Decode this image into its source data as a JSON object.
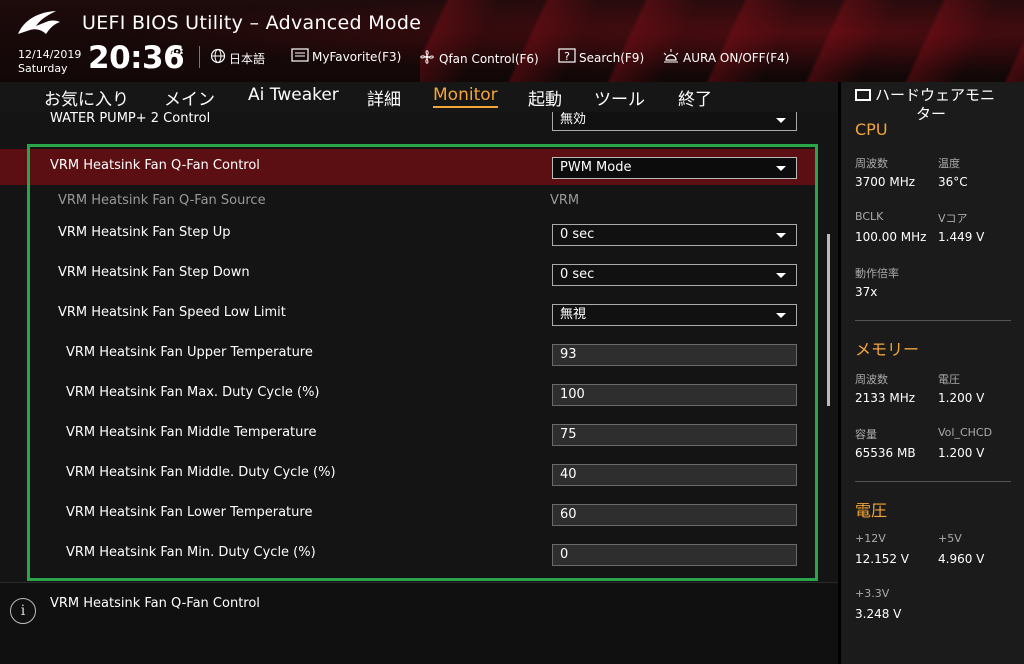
{
  "header": {
    "title": "UEFI BIOS Utility – Advanced Mode",
    "date": "12/14/2019",
    "day": "Saturday",
    "time": "20:36",
    "tools": {
      "language": "日本語",
      "myfavorite": "MyFavorite(F3)",
      "qfan": "Qfan Control(F6)",
      "search": "Search(F9)",
      "aura": "AURA ON/OFF(F4)"
    }
  },
  "tabs": [
    "お気に入り",
    "メイン",
    "Ai Tweaker",
    "詳細",
    "Monitor",
    "起動",
    "ツール",
    "終了"
  ],
  "active_tab": "Monitor",
  "settings": {
    "partial": {
      "label": "WATER PUMP+ 2 Control",
      "value": "無効"
    },
    "items": [
      {
        "label": "VRM Heatsink Fan Q-Fan Control",
        "value": "PWM Mode"
      },
      {
        "label": "VRM Heatsink Fan Q-Fan Source",
        "value": "VRM"
      },
      {
        "label": "VRM Heatsink Fan Step Up",
        "value": "0 sec"
      },
      {
        "label": "VRM Heatsink Fan Step Down",
        "value": "0 sec"
      },
      {
        "label": "VRM Heatsink Fan Speed Low Limit",
        "value": "無視"
      },
      {
        "label": "VRM Heatsink Fan Upper Temperature",
        "value": "93"
      },
      {
        "label": "VRM Heatsink Fan Max. Duty Cycle (%)",
        "value": "100"
      },
      {
        "label": "VRM Heatsink Fan Middle Temperature",
        "value": "75"
      },
      {
        "label": "VRM Heatsink Fan Middle. Duty Cycle (%)",
        "value": "40"
      },
      {
        "label": "VRM Heatsink Fan Lower Temperature",
        "value": "60"
      },
      {
        "label": "VRM Heatsink Fan Min. Duty Cycle (%)",
        "value": "0"
      }
    ]
  },
  "info": {
    "text": "VRM Heatsink Fan Q-Fan Control"
  },
  "hw_monitor": {
    "title": "ハードウェアモニター",
    "title_line1": "ハードウェアモニ",
    "title_line2": "ター",
    "cpu": {
      "heading": "CPU",
      "freq_label": "周波数",
      "freq": "3700 MHz",
      "temp_label": "温度",
      "temp": "36°C",
      "bclk_label": "BCLK",
      "bclk": "100.00 MHz",
      "vcore_label": "Vコア",
      "vcore": "1.449 V",
      "ratio_label": "動作倍率",
      "ratio": "37x"
    },
    "memory": {
      "heading": "メモリー",
      "freq_label": "周波数",
      "freq": "2133 MHz",
      "volt_label": "電圧",
      "volt": "1.200 V",
      "cap_label": "容量",
      "cap": "65536 MB",
      "chcd_label": "Vol_CHCD",
      "chcd": "1.200 V"
    },
    "voltage": {
      "heading": "電圧",
      "v12_label": "+12V",
      "v12": "12.152 V",
      "v5_label": "+5V",
      "v5": "4.960 V",
      "v33_label": "+3.3V",
      "v33": "3.248 V"
    }
  }
}
